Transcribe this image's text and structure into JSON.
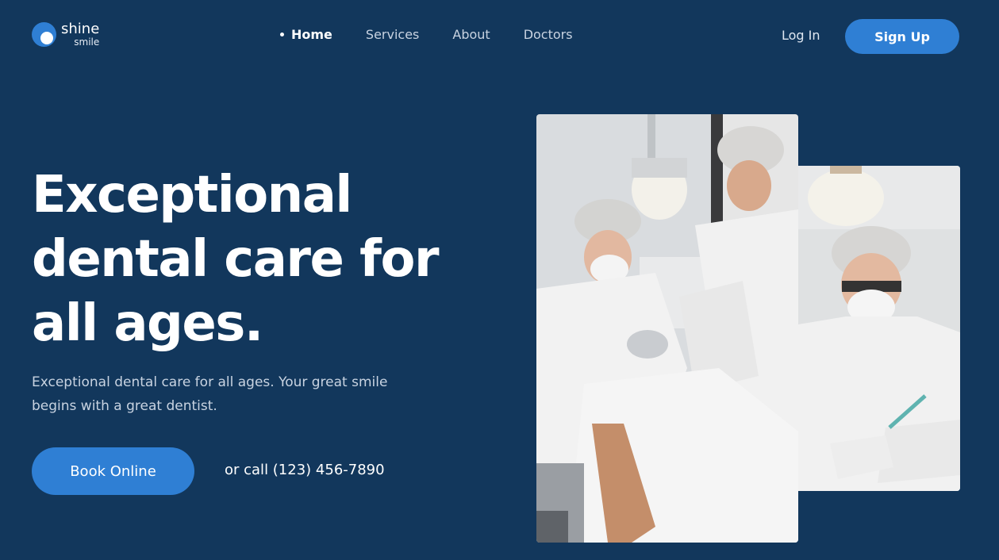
{
  "brand": {
    "name": "shine",
    "sub": "smile"
  },
  "nav": {
    "items": [
      {
        "label": "Home",
        "active": true
      },
      {
        "label": "Services",
        "active": false
      },
      {
        "label": "About",
        "active": false
      },
      {
        "label": "Doctors",
        "active": false
      }
    ],
    "login_label": "Log In",
    "signup_label": "Sign Up"
  },
  "hero": {
    "title": "Exceptional dental care for all ages.",
    "subtitle": "Exceptional dental care for all ages. Your great smile begins with a great dentist.",
    "cta_label": "Book Online",
    "call_text": "or call (123) 456-7890"
  },
  "colors": {
    "background": "#12375c",
    "accent": "#2f7fd4",
    "muted_text": "#c8d3e1"
  }
}
